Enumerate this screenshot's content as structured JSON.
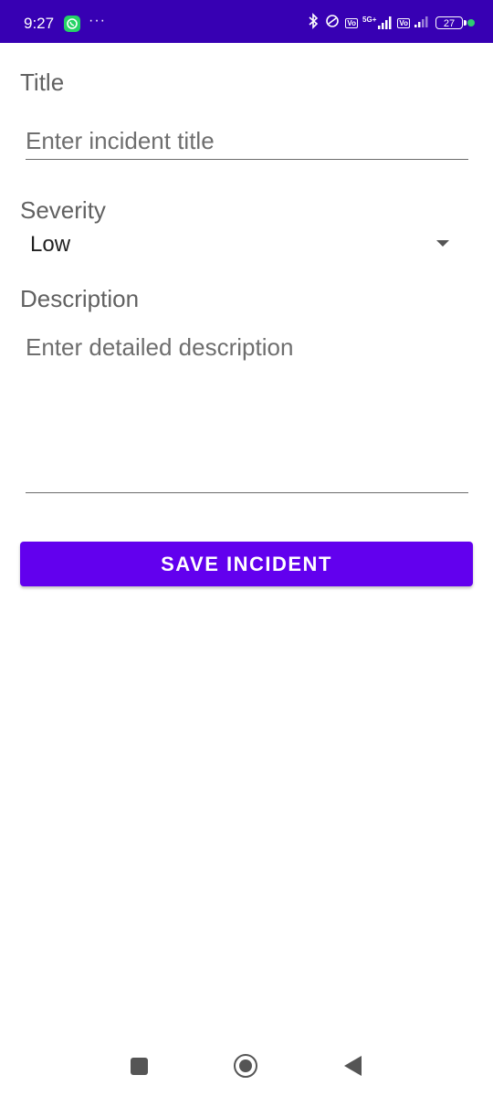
{
  "status_bar": {
    "time": "9:27",
    "more": "···",
    "network_badge_1": "Vo",
    "network_label": "5G+",
    "network_badge_2": "Vo",
    "battery": "27",
    "background_color": "#3700B3"
  },
  "form": {
    "title_label": "Title",
    "title_placeholder": "Enter incident title",
    "severity_label": "Severity",
    "severity_value": "Low",
    "description_label": "Description",
    "description_placeholder": "Enter detailed description",
    "save_button": "SAVE INCIDENT",
    "accent_color": "#6200EE"
  },
  "icons": {
    "whatsapp": "whatsapp-icon",
    "bluetooth": "bluetooth-icon",
    "link": "link-icon",
    "signal": "signal-icon",
    "battery": "battery-icon",
    "dropdown": "chevron-down-icon",
    "nav_recents": "recents-icon",
    "nav_home": "home-icon",
    "nav_back": "back-icon"
  }
}
